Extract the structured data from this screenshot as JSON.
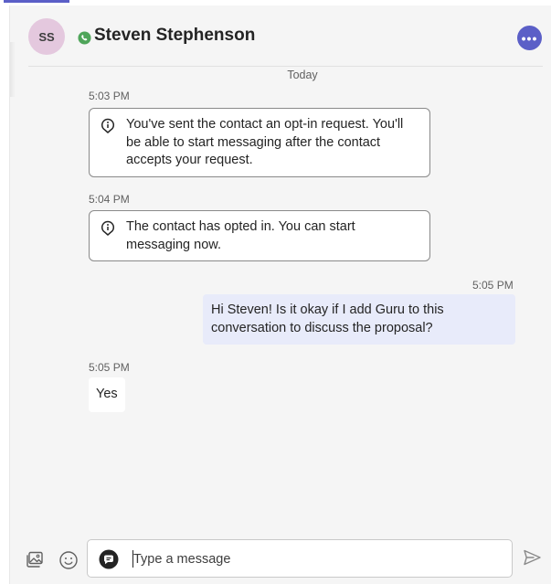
{
  "header": {
    "avatar_initials": "SS",
    "contact_name": "Steven Stephenson",
    "channel_icon": "whatsapp-icon",
    "more_label": "•••",
    "accent_color": "#5b5fc7"
  },
  "conversation": {
    "date_label": "Today",
    "messages": [
      {
        "type": "system",
        "time": "5:03 PM",
        "text": "You've sent the contact an opt-in request. You'll be able to start messaging after the contact accepts your request.",
        "icon": "info-icon"
      },
      {
        "type": "system",
        "time": "5:04 PM",
        "text": "The contact has opted in. You can start messaging now.",
        "icon": "info-icon"
      },
      {
        "type": "outgoing",
        "time": "5:05 PM",
        "text": "Hi Steven! Is it okay if I add Guru to this conversation to discuss the proposal?"
      },
      {
        "type": "incoming",
        "time": "5:05 PM",
        "text": "Yes"
      }
    ]
  },
  "composer": {
    "placeholder": "Type a message",
    "left_icons": [
      "media-gallery-icon",
      "emoji-icon"
    ],
    "inner_icon": "chat-bubble-icon",
    "send_icon": "send-icon"
  }
}
